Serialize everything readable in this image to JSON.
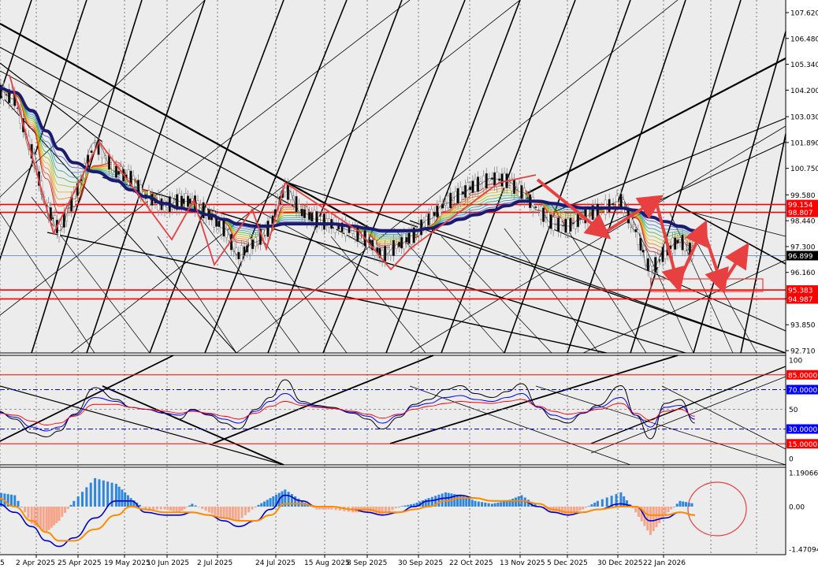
{
  "colors": {
    "background": "#ececec",
    "grid": "#000000",
    "price_candles": "#8a8a8a",
    "ma_thick": "#1a1a6e",
    "hline": "#ff0000",
    "current_price_box": "#000000",
    "red_label": "#ff0000",
    "blue_label": "#0000ff",
    "rsi_main": "#000000",
    "rsi_fast": "#0000ff",
    "rsi_slow": "#ff0000",
    "macd_pos": "#2e86de",
    "macd_neg": "#f5a58a",
    "macd_signal": "#ff8c00",
    "macd_line": "#0000cc",
    "annotation": "#e84040"
  },
  "price_axis": {
    "ticks": [
      "107.620",
      "106.480",
      "105.340",
      "104.200",
      "103.030",
      "101.890",
      "100.750",
      "99.580",
      "98.440",
      "97.300",
      "96.160",
      "95.010",
      "93.850",
      "92.710"
    ],
    "labels": [
      {
        "text": "99.154",
        "price": 99.154,
        "style": "red"
      },
      {
        "text": "98.807",
        "price": 98.807,
        "style": "red"
      },
      {
        "text": "96.899",
        "price": 96.899,
        "style": "current"
      },
      {
        "text": "95.383",
        "price": 95.383,
        "style": "red"
      },
      {
        "text": "94.987",
        "price": 94.987,
        "style": "red"
      }
    ],
    "range": [
      92.4,
      108.0
    ]
  },
  "rsi_axis": {
    "ticks": [
      "100",
      "50",
      "0"
    ],
    "levels": [
      {
        "text": "85.0000",
        "value": 85,
        "style": "red"
      },
      {
        "text": "70.0000",
        "value": 70,
        "style": "blue"
      },
      {
        "text": "30.0000",
        "value": 30,
        "style": "blue"
      },
      {
        "text": "15.0000",
        "value": 15,
        "style": "red"
      }
    ]
  },
  "macd_axis": {
    "ticks": [
      "1.19066",
      "0.00",
      "-1.47094"
    ],
    "range": [
      -1.6,
      1.3
    ]
  },
  "time_axis": [
    "2 Apr 2025",
    "25 Apr 2025",
    "19 May 2025",
    "10 Jun 2025",
    "2 Jul 2025",
    "24 Jul 2025",
    "15 Aug 2025",
    "8 Sep 2025",
    "30 Sep 2025",
    "22 Oct 2025",
    "13 Nov 2025",
    "5 Dec 2025",
    "30 Dec 2025",
    "22 Jan 2026"
  ],
  "time_axis_partial_label": "5",
  "chart_data": [
    {
      "type": "line",
      "title": "",
      "xlabel": "",
      "ylabel": "",
      "ylim": [
        92.71,
        107.62
      ],
      "x": [
        "2025-03-10",
        "2025-03-18",
        "2025-03-26",
        "2025-04-02",
        "2025-04-08",
        "2025-04-15",
        "2025-04-25",
        "2025-05-05",
        "2025-05-12",
        "2025-05-19",
        "2025-05-28",
        "2025-06-04",
        "2025-06-10",
        "2025-06-18",
        "2025-06-25",
        "2025-07-02",
        "2025-07-10",
        "2025-07-17",
        "2025-07-24",
        "2025-08-01",
        "2025-08-08",
        "2025-08-15",
        "2025-08-25",
        "2025-09-01",
        "2025-09-08",
        "2025-09-16",
        "2025-09-23",
        "2025-09-30",
        "2025-10-08",
        "2025-10-15",
        "2025-10-22",
        "2025-10-30",
        "2025-11-06",
        "2025-11-13",
        "2025-11-21",
        "2025-11-28",
        "2025-12-05",
        "2025-12-12",
        "2025-12-19",
        "2025-12-30",
        "2026-01-06",
        "2026-01-13",
        "2026-01-20",
        "2026-01-27",
        "2026-02-03"
      ],
      "series": [
        {
          "values": [
            104.2,
            103.8,
            101.5,
            99.1,
            98.0,
            99.4,
            101.9,
            100.6,
            100.3,
            99.5,
            99.1,
            99.3,
            99.3,
            98.7,
            98.1,
            96.9,
            97.5,
            98.2,
            99.9,
            98.8,
            98.5,
            98.3,
            98.0,
            97.6,
            96.9,
            97.4,
            97.8,
            98.5,
            99.2,
            99.6,
            100.0,
            100.3,
            100.2,
            99.7,
            98.9,
            98.3,
            98.2,
            98.6,
            98.9,
            99.3,
            98.0,
            96.2,
            97.1,
            97.6,
            96.9
          ]
        },
        {
          "values": [
            104.3,
            104.1,
            103.3,
            102.4,
            101.6,
            101.0,
            100.6,
            100.2,
            99.8,
            99.5,
            99.2,
            99.0,
            98.9,
            98.7,
            98.5,
            98.3,
            98.2,
            98.2,
            98.3,
            98.3,
            98.3,
            98.3,
            98.2,
            98.1,
            98.0,
            98.0,
            98.0,
            98.1,
            98.3,
            98.5,
            98.7,
            98.9,
            99.1,
            99.3,
            99.3,
            99.2,
            99.1,
            99.0,
            99.0,
            99.0,
            98.9,
            98.6,
            98.4,
            98.2,
            98.0
          ]
        }
      ]
    },
    {
      "type": "line",
      "title": "",
      "ylim": [
        0,
        100
      ],
      "x": [
        "2025-03-10",
        "2025-03-18",
        "2025-03-26",
        "2025-04-02",
        "2025-04-08",
        "2025-04-15",
        "2025-04-25",
        "2025-05-05",
        "2025-05-12",
        "2025-05-19",
        "2025-05-28",
        "2025-06-04",
        "2025-06-10",
        "2025-06-18",
        "2025-06-25",
        "2025-07-02",
        "2025-07-10",
        "2025-07-17",
        "2025-07-24",
        "2025-08-01",
        "2025-08-08",
        "2025-08-15",
        "2025-08-25",
        "2025-09-01",
        "2025-09-08",
        "2025-09-16",
        "2025-09-23",
        "2025-09-30",
        "2025-10-08",
        "2025-10-15",
        "2025-10-22",
        "2025-10-30",
        "2025-11-06",
        "2025-11-13",
        "2025-11-21",
        "2025-11-28",
        "2025-12-05",
        "2025-12-12",
        "2025-12-19",
        "2025-12-30",
        "2026-01-06",
        "2026-01-13",
        "2026-01-20",
        "2026-01-27",
        "2026-02-03"
      ],
      "series": [
        {
          "values": [
            48,
            40,
            26,
            22,
            28,
            45,
            72,
            60,
            52,
            50,
            46,
            40,
            50,
            44,
            36,
            30,
            50,
            62,
            80,
            58,
            54,
            52,
            46,
            40,
            30,
            42,
            55,
            60,
            70,
            74,
            66,
            62,
            68,
            76,
            52,
            40,
            36,
            46,
            54,
            74,
            44,
            20,
            56,
            60,
            36
          ]
        },
        {
          "values": [
            47,
            42,
            32,
            28,
            32,
            44,
            62,
            58,
            52,
            50,
            46,
            44,
            49,
            45,
            40,
            36,
            48,
            58,
            66,
            56,
            53,
            51,
            47,
            43,
            36,
            44,
            53,
            56,
            62,
            64,
            60,
            58,
            62,
            66,
            52,
            44,
            40,
            46,
            52,
            62,
            44,
            32,
            52,
            54,
            40
          ]
        },
        {
          "values": [
            46,
            44,
            38,
            34,
            36,
            43,
            55,
            55,
            52,
            50,
            48,
            46,
            48,
            46,
            43,
            40,
            46,
            53,
            58,
            54,
            52,
            51,
            48,
            45,
            41,
            45,
            50,
            53,
            56,
            58,
            57,
            56,
            58,
            60,
            53,
            48,
            45,
            47,
            50,
            56,
            46,
            39,
            48,
            50,
            43
          ]
        }
      ]
    },
    {
      "type": "bar",
      "title": "",
      "ylim": [
        -1.47094,
        1.19066
      ],
      "x": [
        "2025-03-10",
        "2025-03-18",
        "2025-03-26",
        "2025-04-02",
        "2025-04-08",
        "2025-04-15",
        "2025-04-25",
        "2025-05-05",
        "2025-05-12",
        "2025-05-19",
        "2025-05-28",
        "2025-06-04",
        "2025-06-10",
        "2025-06-18",
        "2025-06-25",
        "2025-07-02",
        "2025-07-10",
        "2025-07-17",
        "2025-07-24",
        "2025-08-01",
        "2025-08-08",
        "2025-08-15",
        "2025-08-25",
        "2025-09-01",
        "2025-09-08",
        "2025-09-16",
        "2025-09-23",
        "2025-09-30",
        "2025-10-08",
        "2025-10-15",
        "2025-10-22",
        "2025-10-30",
        "2025-11-06",
        "2025-11-13",
        "2025-11-21",
        "2025-11-28",
        "2025-12-05",
        "2025-12-12",
        "2025-12-19",
        "2025-12-30",
        "2026-01-06",
        "2026-01-13",
        "2026-01-20",
        "2026-01-27",
        "2026-02-03"
      ],
      "series": [
        {
          "values": [
            0.5,
            0.4,
            -0.6,
            -0.9,
            -0.5,
            0.2,
            1.0,
            0.8,
            0.3,
            -0.1,
            -0.1,
            -0.2,
            0.1,
            -0.2,
            -0.4,
            -0.5,
            0.0,
            0.3,
            0.6,
            0.2,
            -0.1,
            -0.1,
            -0.2,
            -0.2,
            -0.3,
            0.0,
            0.1,
            0.3,
            0.5,
            0.4,
            0.2,
            0.1,
            0.2,
            0.4,
            0.0,
            -0.2,
            -0.3,
            -0.1,
            0.2,
            0.5,
            -0.2,
            -1.0,
            -0.3,
            0.2,
            0.1
          ]
        },
        {
          "values": [
            0.1,
            -0.2,
            -0.7,
            -1.2,
            -1.4,
            -1.1,
            -0.4,
            0.2,
            0.2,
            -0.2,
            -0.3,
            -0.3,
            -0.2,
            -0.3,
            -0.5,
            -0.7,
            -0.5,
            -0.1,
            0.4,
            0.2,
            0.0,
            0.0,
            -0.1,
            -0.2,
            -0.3,
            -0.2,
            0.0,
            0.2,
            0.3,
            0.4,
            0.3,
            0.2,
            0.2,
            0.2,
            0.0,
            -0.2,
            -0.3,
            -0.2,
            -0.1,
            0.1,
            0.0,
            -0.5,
            -0.4,
            -0.2,
            -0.3
          ]
        },
        {
          "values": [
            0.3,
            0.0,
            -0.5,
            -0.9,
            -1.2,
            -1.2,
            -0.8,
            -0.3,
            0.0,
            -0.1,
            -0.2,
            -0.2,
            -0.2,
            -0.3,
            -0.4,
            -0.5,
            -0.5,
            -0.3,
            0.1,
            0.1,
            0.0,
            0.0,
            -0.1,
            -0.1,
            -0.2,
            -0.2,
            -0.1,
            0.0,
            0.2,
            0.3,
            0.3,
            0.2,
            0.2,
            0.2,
            0.1,
            -0.1,
            -0.2,
            -0.2,
            -0.1,
            0.0,
            0.0,
            -0.3,
            -0.3,
            -0.2,
            -0.3
          ]
        }
      ]
    }
  ]
}
